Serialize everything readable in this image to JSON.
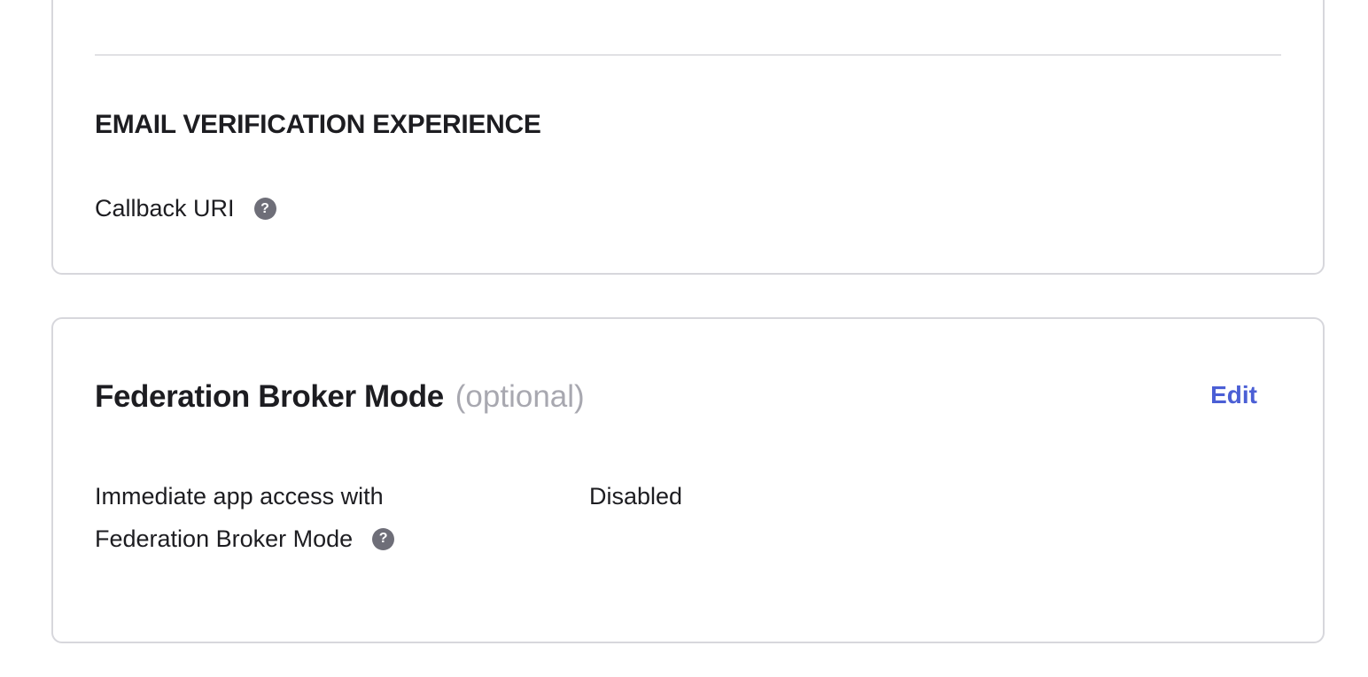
{
  "email_verification": {
    "heading": "EMAIL VERIFICATION EXPERIENCE",
    "callback_uri_label": "Callback URI",
    "help_icon": "question-circle-icon",
    "help_glyph": "?"
  },
  "federation_broker": {
    "title": "Federation Broker Mode",
    "title_suffix": "(optional)",
    "edit_label": "Edit",
    "setting_label_line1": "Immediate app access with",
    "setting_label_line2": "Federation Broker Mode",
    "setting_value": "Disabled",
    "help_icon": "question-circle-icon",
    "help_glyph": "?"
  },
  "colors": {
    "link": "#4b5fd5",
    "muted": "#a8a8b0",
    "border": "#d7d7dc",
    "text": "#1d1d21"
  }
}
